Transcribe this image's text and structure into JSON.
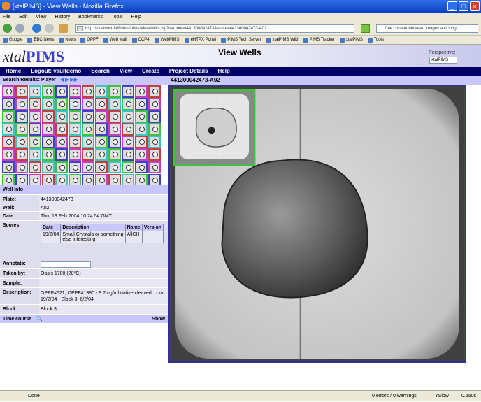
{
  "window": {
    "title": "[xtalPIMS] - View Wells - Mozilla Firefox"
  },
  "menu": [
    "File",
    "Edit",
    "View",
    "History",
    "Bookmarks",
    "Tools",
    "Help"
  ],
  "nav": {
    "url": "http://localhost:8080/xtalpims/ViewWells.jsp?barcode=441300042473&score=441300042473-A02",
    "search_placeholder": "free content between images and long"
  },
  "bookmarks": [
    "Google",
    "BBC News",
    "News",
    "OPPF",
    "Web Mail",
    "CCP4",
    "WebPIMS",
    "eHTPX Portal",
    "PIMS Tech Server",
    "xtalPIMS Wiki",
    "PIMS Tracker",
    "xtalPIMS",
    "Tools"
  ],
  "app": {
    "logo_text": "xtal",
    "logo_accent": "PIMS",
    "page_title": "View Wells",
    "perspective_label": "Perspective:",
    "perspective_value": "xtalPIMS"
  },
  "mainnav": [
    "Home",
    "Logout: vaultdemo",
    "Search",
    "View",
    "Create",
    "Project Details",
    "Help"
  ],
  "left": {
    "search_results": "Search Results: Player",
    "wells_grid": {
      "rows": 8,
      "cols": 12,
      "border_colors": [
        "#c040c0",
        "#40c0c0",
        "#4040c0",
        "#c04040",
        "#40c040"
      ]
    },
    "well_info_title": "Well Info",
    "plate_label": "Plate:",
    "plate_value": "441300042473",
    "well_label": "Well:",
    "well_value": "A02",
    "date_label": "Date:",
    "date_value": "Thu, 19 Feb 2004 10:24:54 GMT",
    "scores_label": "Scores:",
    "scores_headers": [
      "Date",
      "Description",
      "Name",
      "Version"
    ],
    "scores_rows": [
      {
        "date": "19/2/04",
        "description": "Small Crystals or something else interesting",
        "name": "AllCH",
        "version": ""
      }
    ],
    "annotate_label": "Annotate:",
    "taken_by_label": "Taken by:",
    "taken_by_value": "Oasis 1700 (20°C)",
    "sample_label": "Sample:",
    "sample_value": "",
    "description_label": "Description:",
    "description_value": "OPPF#621, OPPF#1380 - 9.7mg/ml native cleaved, conc. 19/2/04 - Block 3, 6/2/04",
    "block_label": "Block:",
    "block_value": "Block 3",
    "timecourse_label": "Time course",
    "show_label": "Show"
  },
  "image": {
    "title": "441300042473-A02"
  },
  "status": {
    "left": "Done",
    "errors": "0 errors / 0 warnings",
    "yslow": "YSlow",
    "time": "0.650s"
  },
  "colors": {
    "nav_bg": "#000066",
    "panel_head": "#c8c8ff",
    "title_bar": "#2f6ee8"
  }
}
